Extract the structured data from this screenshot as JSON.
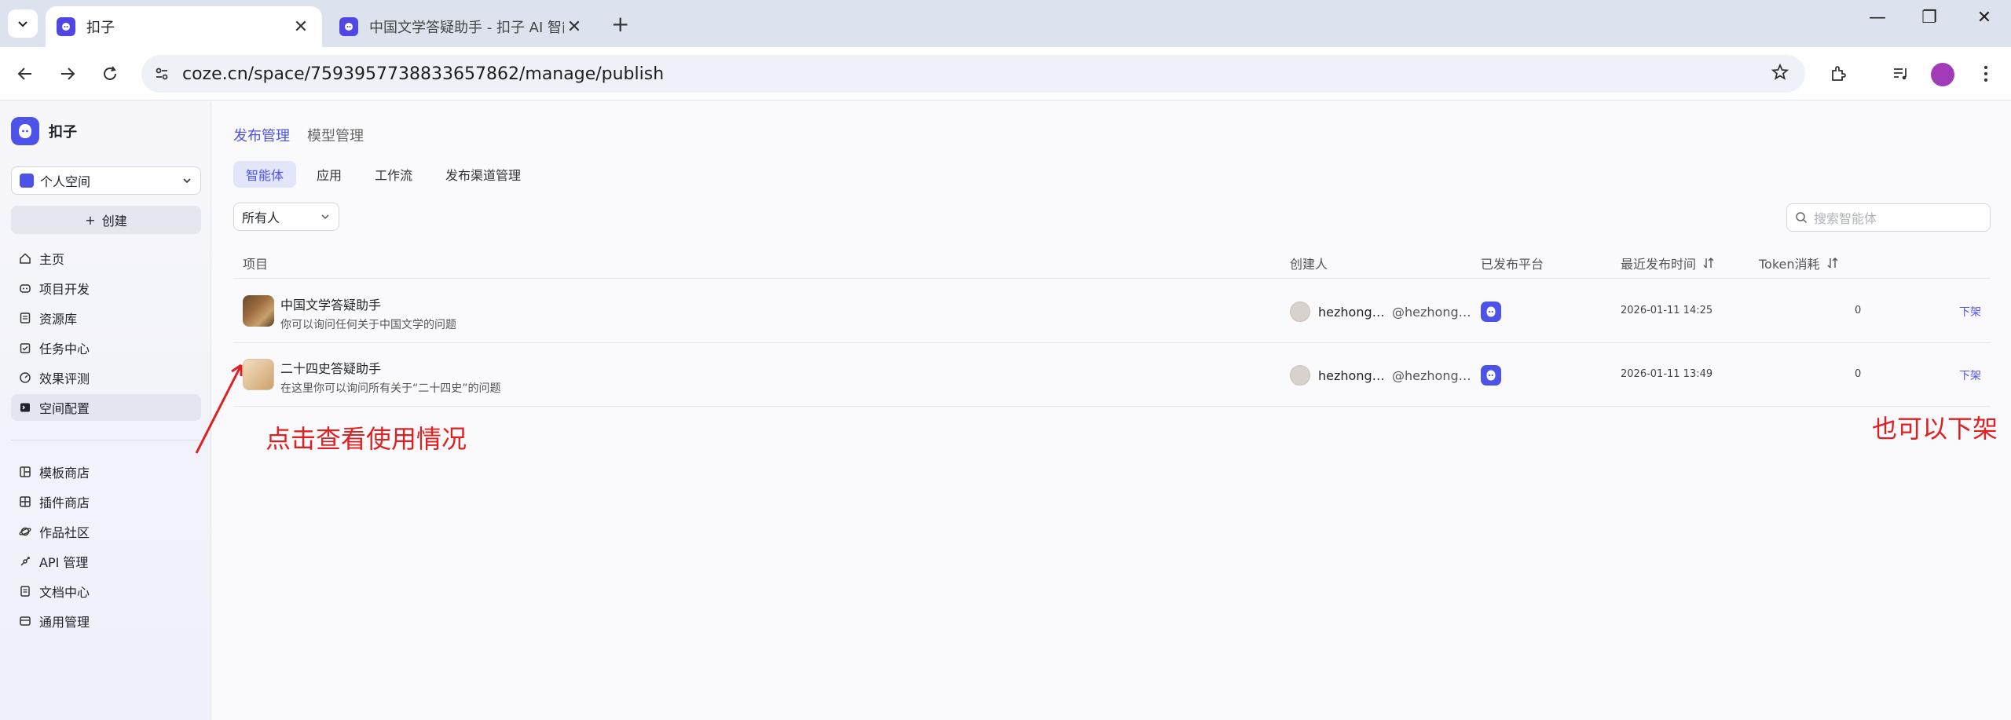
{
  "browser": {
    "tabs": [
      {
        "title": "扣子",
        "active": true
      },
      {
        "title": "中国文学答疑助手 - 扣子 AI 智能体",
        "active": false
      }
    ],
    "url": "coze.cn/space/7593957738833657862/manage/publish",
    "brand_color": "#4d53e8"
  },
  "sidebar": {
    "brand": "扣子",
    "space": "个人空间",
    "create": "创建",
    "items": [
      {
        "label": "主页",
        "icon": "home-icon"
      },
      {
        "label": "项目开发",
        "icon": "project-icon"
      },
      {
        "label": "资源库",
        "icon": "library-icon"
      },
      {
        "label": "任务中心",
        "icon": "task-icon"
      },
      {
        "label": "效果评测",
        "icon": "eval-icon"
      },
      {
        "label": "空间配置",
        "icon": "config-icon",
        "active": true
      }
    ],
    "items2": [
      {
        "label": "模板商店",
        "icon": "template-icon"
      },
      {
        "label": "插件商店",
        "icon": "plugin-icon"
      },
      {
        "label": "作品社区",
        "icon": "community-icon"
      },
      {
        "label": "API 管理",
        "icon": "api-icon"
      },
      {
        "label": "文档中心",
        "icon": "doc-icon"
      },
      {
        "label": "通用管理",
        "icon": "manage-icon"
      }
    ]
  },
  "main": {
    "top_tabs": [
      "发布管理",
      "模型管理"
    ],
    "sub_tabs": [
      "智能体",
      "应用",
      "工作流",
      "发布渠道管理"
    ],
    "owner_filter": "所有人",
    "search_placeholder": "搜索智能体",
    "columns": [
      "项目",
      "创建人",
      "已发布平台",
      "最近发布时间",
      "Token消耗"
    ],
    "rows": [
      {
        "name": "中国文学答疑助手",
        "desc": "你可以询问任何关于中国文学的问题",
        "creator": "hezhong…",
        "handle": "@hezhong…",
        "time": "2026-01-11 14:25",
        "tokens": "0",
        "action": "下架"
      },
      {
        "name": "二十四史答疑助手",
        "desc": "在这里你可以询问所有关于“二十四史”的问题",
        "creator": "hezhong…",
        "handle": "@hezhong…",
        "time": "2026-01-11 13:49",
        "tokens": "0",
        "action": "下架"
      }
    ]
  },
  "annotations": {
    "left": "点击查看使用情况",
    "right": "也可以下架",
    "color": "#e02020"
  }
}
